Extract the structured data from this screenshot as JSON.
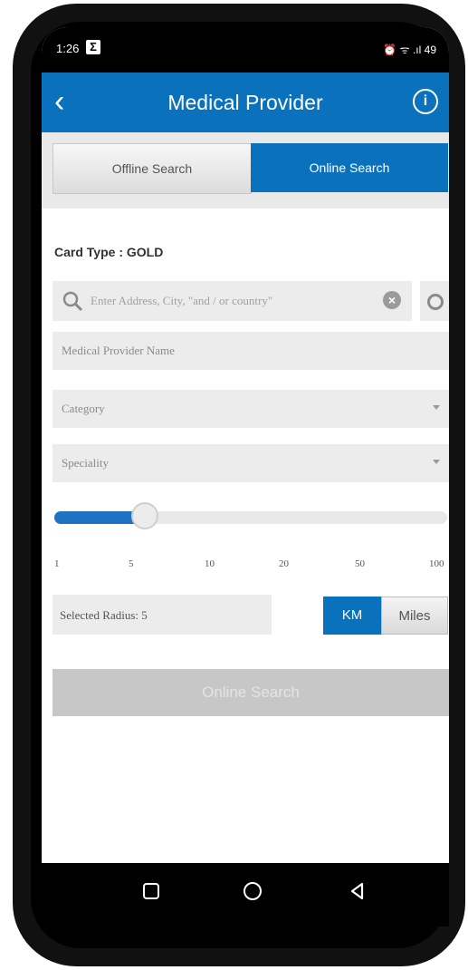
{
  "status_bar": {
    "time": "1:26",
    "notif_icon": "Σ",
    "right_icons": "⏰ ᯤ .ıl 49"
  },
  "app_bar": {
    "title": "Medical Provider",
    "back_icon": "chevron-left-icon",
    "info_icon": "info-icon"
  },
  "tabs": [
    {
      "label": "Offline Search",
      "active": false
    },
    {
      "label": "Online Search",
      "active": true
    }
  ],
  "card_type": "Card Type : GOLD",
  "search": {
    "placeholder": "Enter Address, City, \"and / or country\""
  },
  "provider_name": {
    "placeholder": "Medical Provider Name"
  },
  "category": {
    "value": "Category"
  },
  "speciality": {
    "value": "Speciality"
  },
  "radius_slider": {
    "ticks": [
      "1",
      "5",
      "10",
      "20",
      "50",
      "100"
    ],
    "selected_index": 1
  },
  "selected_radius": "Selected Radius: 5",
  "units": {
    "km": "KM",
    "miles": "Miles",
    "selected": "KM"
  },
  "search_button": "Online Search",
  "colors": {
    "primary": "#0a71bd",
    "disabled": "#c7c7c7"
  }
}
